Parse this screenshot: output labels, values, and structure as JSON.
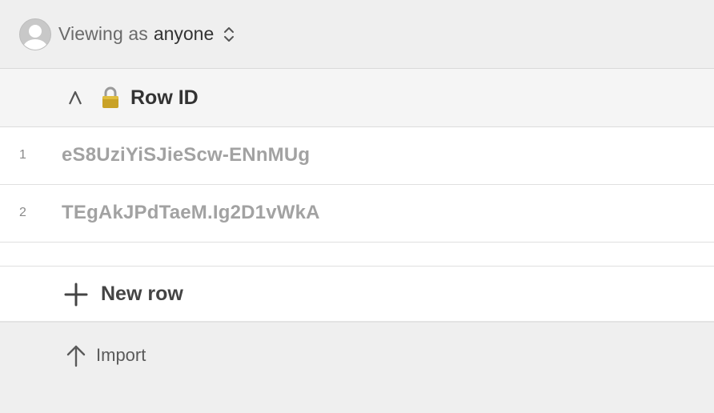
{
  "viewer": {
    "prefix": "Viewing as",
    "who": "anyone"
  },
  "table": {
    "column": {
      "type_glyph": "A",
      "locked": true,
      "title": "Row ID"
    },
    "rows": [
      {
        "index": "1",
        "row_id": "eS8UziYiSJieScw-ENnMUg"
      },
      {
        "index": "2",
        "row_id": "TEgAkJPdTaeM.Ig2D1vWkA"
      }
    ],
    "new_row_label": "New row"
  },
  "import_label": "Import",
  "icons": {
    "avatar": "user-avatar-icon",
    "updown": "chevron-updown-icon",
    "type": "text-type-icon",
    "lock": "lock-icon",
    "plus": "plus-icon",
    "import": "arrow-up-icon"
  },
  "colors": {
    "background": "#efefef",
    "row_value": "#a2a2a2",
    "lock_gold": "#c9a227"
  }
}
